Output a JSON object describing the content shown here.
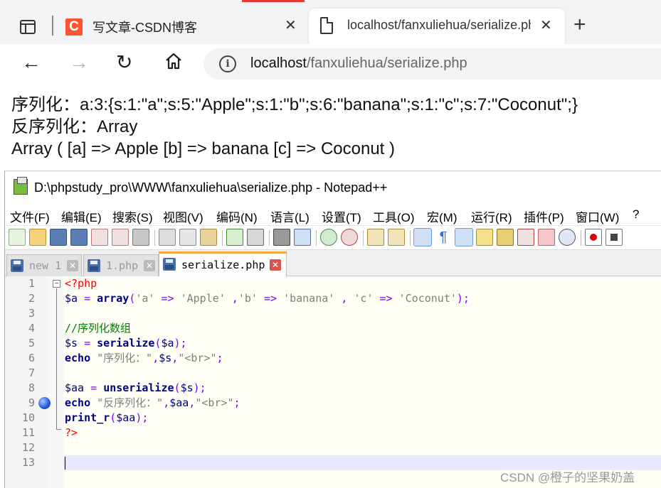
{
  "browser": {
    "tabs": [
      {
        "title": "写文章-CSDN博客",
        "icon": "csdn-logo-icon",
        "close": "✕"
      },
      {
        "title": "localhost/fanxuliehua/serialize.ph",
        "icon": "page-icon",
        "close": "✕"
      }
    ],
    "new_tab": "+",
    "nav": {
      "back": "←",
      "forward": "→",
      "reload": "↻"
    },
    "address": {
      "host": "localhost",
      "path": "/fanxuliehua/serialize.php"
    }
  },
  "page_output": {
    "line1": "序列化：a:3:{s:1:\"a\";s:5:\"Apple\";s:1:\"b\";s:6:\"banana\";s:1:\"c\";s:7:\"Coconut\";}",
    "line2": "反序列化：Array",
    "line3": "Array ( [a] => Apple [b] => banana [c] => Coconut )"
  },
  "notepad": {
    "title": "D:\\phpstudy_pro\\WWW\\fanxuliehua\\serialize.php - Notepad++",
    "menu": [
      "文件(F)",
      "编辑(E)",
      "搜索(S)",
      "视图(V)",
      "编码(N)",
      "语言(L)",
      "设置(T)",
      "工具(O)",
      "宏(M)",
      "运行(R)",
      "插件(P)",
      "窗口(W)",
      "?"
    ],
    "file_tabs": [
      {
        "label": "new 1",
        "close": "✕"
      },
      {
        "label": "1.php",
        "close": "✕"
      },
      {
        "label": "serialize.php",
        "close": "✕"
      }
    ],
    "line_numbers": [
      "1",
      "2",
      "3",
      "4",
      "5",
      "6",
      "7",
      "8",
      "9",
      "10",
      "11",
      "12",
      "13"
    ],
    "code": {
      "l1_php_open": "<?php",
      "l2_var": "$a",
      "l2_eq": " = ",
      "l2_kw": "array",
      "l2_p1": "(",
      "l2_s1": "'a'",
      "l2_arrow1": " => ",
      "l2_s2": "'Apple'",
      "l2_comma1": " ,",
      "l2_s3": "'b'",
      "l2_arrow2": " => ",
      "l2_s4": "'banana'",
      "l2_comma2": " , ",
      "l2_s5": "'c'",
      "l2_arrow3": " => ",
      "l2_s6": "'Coconut'",
      "l2_end": ");",
      "l4_comment": "//序列化数组",
      "l5_var": "$s",
      "l5_eq": " = ",
      "l5_fn": "serialize",
      "l5_p1": "(",
      "l5_arg": "$a",
      "l5_end": ");",
      "l6_kw": "echo",
      "l6_s1": " \"序列化：\"",
      "l6_c1": ",",
      "l6_var": "$s",
      "l6_c2": ",",
      "l6_s2": "\"<br>\"",
      "l6_end": ";",
      "l8_var": "$aa",
      "l8_eq": " = ",
      "l8_fn": "unserialize",
      "l8_p1": "(",
      "l8_arg": "$s",
      "l8_end": ");",
      "l9_kw": "echo",
      "l9_s1": " \"反序列化：\"",
      "l9_c1": ",",
      "l9_var": "$aa",
      "l9_c2": ",",
      "l9_s2": "\"<br>\"",
      "l9_end": ";",
      "l10_fn": "print_r",
      "l10_p1": "(",
      "l10_arg": "$aa",
      "l10_end": ");",
      "l11_php_close": "?>"
    }
  },
  "watermark": "CSDN @橙子的坚果奶盖"
}
